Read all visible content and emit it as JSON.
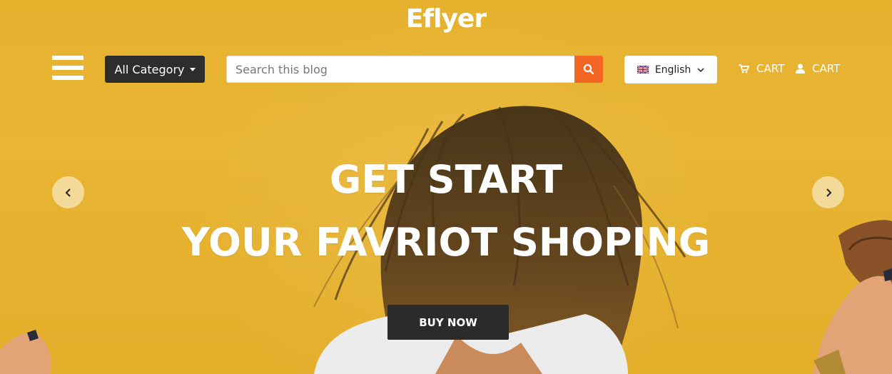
{
  "header": {
    "logo": "Eflyer",
    "category_label": "All Category",
    "search": {
      "placeholder": "Search this blog",
      "value": ""
    },
    "language": "English",
    "cart_links": [
      "CART",
      "CART"
    ]
  },
  "hero": {
    "title_line1": "GET START",
    "title_line2": "YOUR FAVRIOT SHOPING",
    "button_label": "BUY NOW"
  },
  "icons": {
    "menu": "hamburger-icon",
    "search": "search-icon",
    "flag": "uk-flag-icon",
    "cart": "cart-icon",
    "user": "user-icon",
    "prev": "chevron-left-icon",
    "next": "chevron-right-icon"
  },
  "colors": {
    "background": "#e3b02c",
    "accent": "#f26522",
    "dark_button": "#2b2b2b",
    "text_light": "#ffffff"
  }
}
